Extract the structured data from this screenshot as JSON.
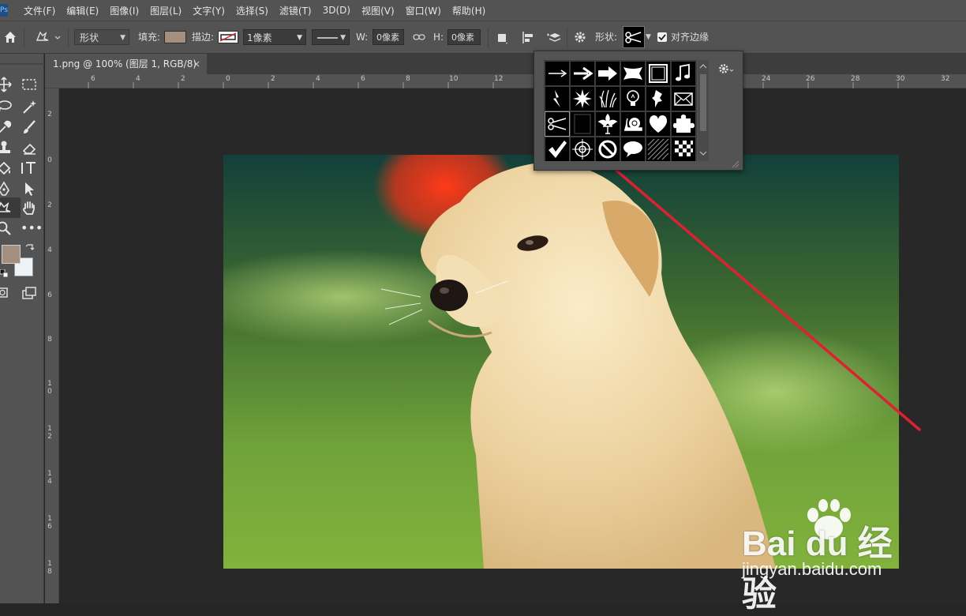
{
  "menu": {
    "app_logo": "Ps",
    "items": [
      "文件(F)",
      "编辑(E)",
      "图像(I)",
      "图层(L)",
      "文字(Y)",
      "选择(S)",
      "滤镜(T)",
      "3D(D)",
      "视图(V)",
      "窗口(W)",
      "帮助(H)"
    ]
  },
  "options": {
    "mode_value": "形状",
    "fill_label": "填充:",
    "fill_color": "#a48f7e",
    "stroke_label": "描边:",
    "stroke_width_value": "1像素",
    "w_label": "W:",
    "w_value": "0像素",
    "h_label": "H:",
    "h_value": "0像素",
    "shape_label": "形状:",
    "align_edges_label": "对齐边缘",
    "align_edges_checked": true
  },
  "tools": {
    "foreground_color": "#a48f7e",
    "background_color": "#eef3f8"
  },
  "document": {
    "tab_title": "1.png @ 100% (图层 1, RGB/8)",
    "close_glyph": "×"
  },
  "rulers": {
    "horizontal": [
      "6",
      "4",
      "2",
      "0",
      "2",
      "4",
      "6",
      "8",
      "10",
      "12",
      "24",
      "26",
      "28",
      "30",
      "32"
    ],
    "vertical": [
      "2",
      "0",
      "2",
      "4",
      "6",
      "8",
      "10",
      "12",
      "14",
      "16",
      "18"
    ]
  },
  "shape_picker": {
    "shapes": [
      "thin-arrow",
      "arrow",
      "bold-arrow",
      "banner",
      "frame",
      "music-note",
      "lightning",
      "starburst",
      "grass",
      "lightbulb",
      "pushpin",
      "envelope",
      "scissors",
      "blank-frame",
      "fleur-de-lis",
      "snail",
      "heart",
      "puzzle-piece",
      "checkmark",
      "target",
      "no-sign",
      "speech-bubble",
      "hatch-pattern",
      "checkerboard"
    ],
    "selected": "scissors"
  },
  "watermark": {
    "brand": "Bai du 经验",
    "url": "jingyan.baidu.com"
  },
  "colors": {
    "annotation_arrow": "#e02030"
  }
}
